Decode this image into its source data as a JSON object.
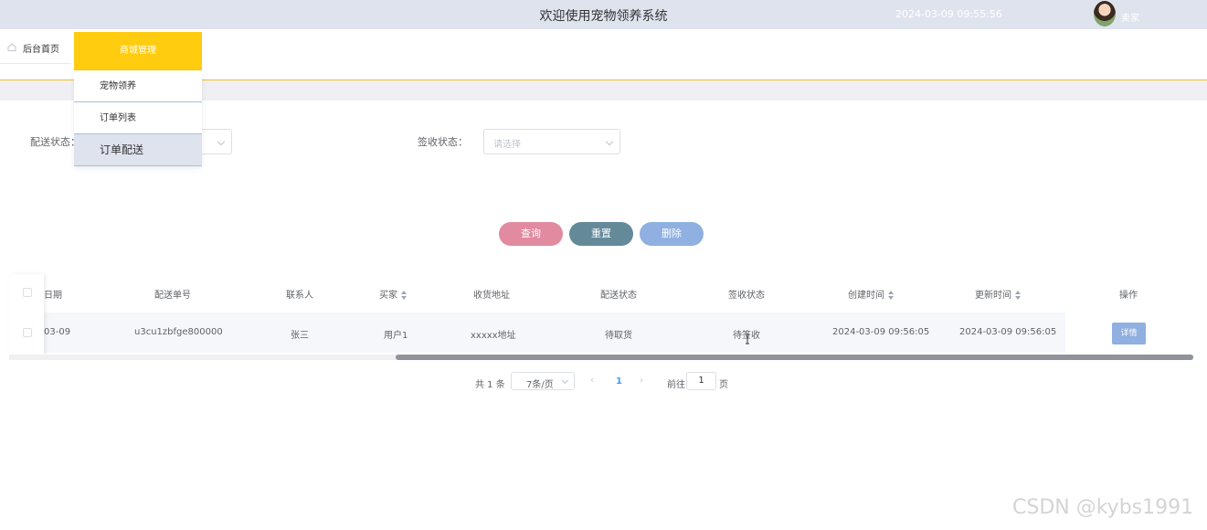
{
  "header": {
    "title": "欢迎使用宠物领养系统",
    "datetime": "2024-03-09 09:55:56",
    "username": "卖家"
  },
  "tabs": {
    "home_label": "后台首页"
  },
  "menu": {
    "header": "商城管理",
    "items": [
      {
        "label": "宠物领养"
      },
      {
        "label": "订单列表"
      },
      {
        "label": "订单配送",
        "active": true
      }
    ]
  },
  "filters": {
    "delivery_label": "配送状态：",
    "receipt_label": "签收状态：",
    "receipt_placeholder": "请选择"
  },
  "actions": {
    "query": "查询",
    "reset": "重置",
    "delete": "删除"
  },
  "table": {
    "columns": [
      "日期",
      "配送单号",
      "联系人",
      "买家",
      "收货地址",
      "配送状态",
      "签收状态",
      "创建时间",
      "更新时间",
      "操作"
    ],
    "rows": [
      {
        "date": "03-09",
        "order_no": "u3cu1zbfge800000",
        "contact": "张三",
        "buyer": "用户1",
        "address": "xxxxx地址",
        "delivery_status": "待取货",
        "receipt_status": "待签收",
        "created": "2024-03-09 09:56:05",
        "updated": "2024-03-09 09:56:05",
        "action": "详情"
      }
    ]
  },
  "pagination": {
    "total": "共 1 条",
    "page_size": "7条/页",
    "prev": "‹",
    "current": "1",
    "next": "›",
    "goto_label": "前往",
    "goto_value": "1",
    "page_suffix": "页"
  },
  "watermark": "CSDN @kybs1991"
}
